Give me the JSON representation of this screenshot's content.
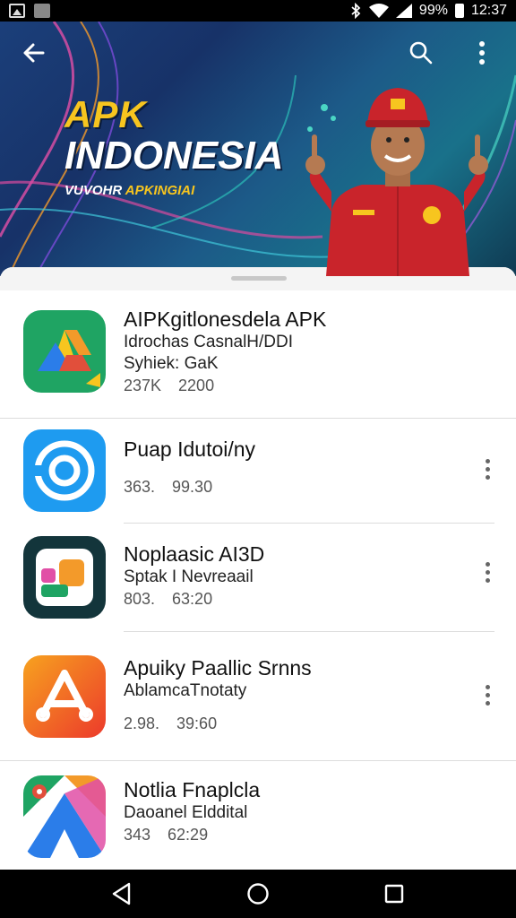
{
  "status_bar": {
    "battery": "99%",
    "time": "12:37",
    "left_icons": [
      "gallery-icon",
      "photo-icon"
    ],
    "right_icons": [
      "bluetooth-icon",
      "wifi-icon",
      "signal-icon",
      "battery-icon"
    ]
  },
  "toolbar": {
    "back_icon": "arrow-left-icon",
    "search_icon": "search-icon",
    "menu_icon": "more-vertical-icon"
  },
  "banner": {
    "line1": "APK",
    "line2": "INDONESIA",
    "line3_prefix": "VUVOHR ",
    "line3_accent": "APKINGIAI",
    "colors": {
      "accent": "#f7c51f",
      "jacket": "#c9242b",
      "bg": "#1b3f7a"
    }
  },
  "apps": [
    {
      "title": "AIPKgitlonesdela APK",
      "subtitle": "Idrochas CasnalH/DDI",
      "subtitle2": "Syhiek: GaK",
      "meta": "237K 2200",
      "icon": "drive-triangle-icon",
      "has_menu": false
    },
    {
      "title": "Puap Idutoi/ny",
      "subtitle": "",
      "subtitle2": "",
      "meta": "363. 99.30",
      "icon": "blue-circle-icon",
      "has_menu": true
    },
    {
      "title": "Noplaasic AI3D",
      "subtitle": "Sptak I Nevreaail",
      "subtitle2": "",
      "meta": "803. 63:20",
      "icon": "colorful-tiles-icon",
      "has_menu": true
    },
    {
      "title": "Apuiky Paallic Srnns",
      "subtitle": "AblamcaTnotaty",
      "subtitle2": "",
      "meta": "2.98. 39:60",
      "icon": "orange-a-icon",
      "has_menu": true
    },
    {
      "title": "Notlia Fnaplcla",
      "subtitle": "Daoanel Elddital",
      "subtitle2": "",
      "meta": "343 62:29",
      "icon": "maps-triangle-icon",
      "has_menu": false
    }
  ],
  "nav": {
    "back": "nav-back-icon",
    "home": "nav-home-icon",
    "recents": "nav-recents-icon"
  }
}
